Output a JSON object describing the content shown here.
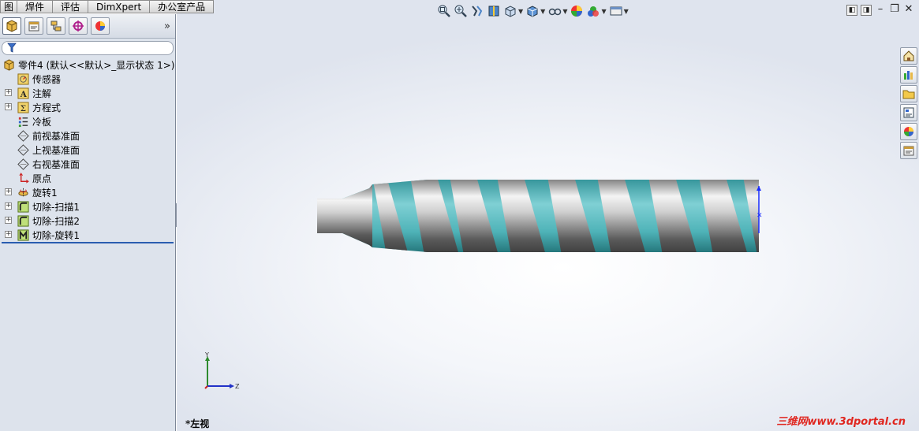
{
  "command_tabs": [
    "图",
    "焊件",
    "评估",
    "DimXpert",
    "办公室产品"
  ],
  "manager_tabs": [
    {
      "icon": "feature-manager-icon",
      "active": true
    },
    {
      "icon": "property-manager-icon",
      "active": false
    },
    {
      "icon": "configuration-manager-icon",
      "active": false
    },
    {
      "icon": "dimxpert-manager-icon",
      "active": false
    },
    {
      "icon": "display-manager-icon",
      "active": false
    }
  ],
  "manager_expand_glyph": "»",
  "tree": {
    "root_label": "零件4  (默认<<默认>_显示状态 1>)",
    "items": [
      {
        "label": "传感器",
        "icon": "sensor-icon",
        "expandable": false
      },
      {
        "label": "注解",
        "icon": "annotation-icon",
        "expandable": true
      },
      {
        "label": "方程式",
        "icon": "equation-icon",
        "expandable": true
      },
      {
        "label": "冷板",
        "icon": "material-icon",
        "expandable": false
      },
      {
        "label": "前视基准面",
        "icon": "plane-icon",
        "expandable": false
      },
      {
        "label": "上视基准面",
        "icon": "plane-icon",
        "expandable": false
      },
      {
        "label": "右视基准面",
        "icon": "plane-icon",
        "expandable": false
      },
      {
        "label": "原点",
        "icon": "origin-icon",
        "expandable": false
      },
      {
        "label": "旋转1",
        "icon": "revolve-icon",
        "expandable": true
      },
      {
        "label": "切除-扫描1",
        "icon": "cut-sweep-icon",
        "expandable": true
      },
      {
        "label": "切除-扫描2",
        "icon": "cut-sweep-icon",
        "expandable": true
      },
      {
        "label": "切除-旋转1",
        "icon": "cut-revolve-icon",
        "expandable": true
      }
    ]
  },
  "viewport": {
    "view_name": "*左视",
    "watermark": "三维网www.3dportal.cn",
    "triad": {
      "x_label": "Z",
      "y_label": "Y"
    },
    "model_colors": {
      "thread": "#4fb3b8",
      "shaft": "#9a9a9a"
    }
  },
  "heads_up_toolbar": [
    {
      "icon": "zoom-to-fit-icon"
    },
    {
      "icon": "zoom-to-area-icon"
    },
    {
      "icon": "previous-view-icon"
    },
    {
      "icon": "section-view-icon"
    },
    {
      "icon": "view-orientation-icon",
      "dropdown": true
    },
    {
      "icon": "display-style-icon",
      "dropdown": true
    },
    {
      "icon": "hide-show-items-icon",
      "dropdown": true
    },
    {
      "icon": "edit-appearance-icon"
    },
    {
      "icon": "apply-scene-icon",
      "dropdown": true
    },
    {
      "icon": "view-settings-icon",
      "dropdown": true
    }
  ],
  "task_pane": [
    "home-icon",
    "design-library-icon",
    "file-explorer-icon",
    "view-palette-icon",
    "appearances-icon",
    "custom-properties-icon"
  ],
  "window_buttons": [
    "tile-left",
    "tile-right",
    "minimize",
    "restore",
    "close"
  ]
}
